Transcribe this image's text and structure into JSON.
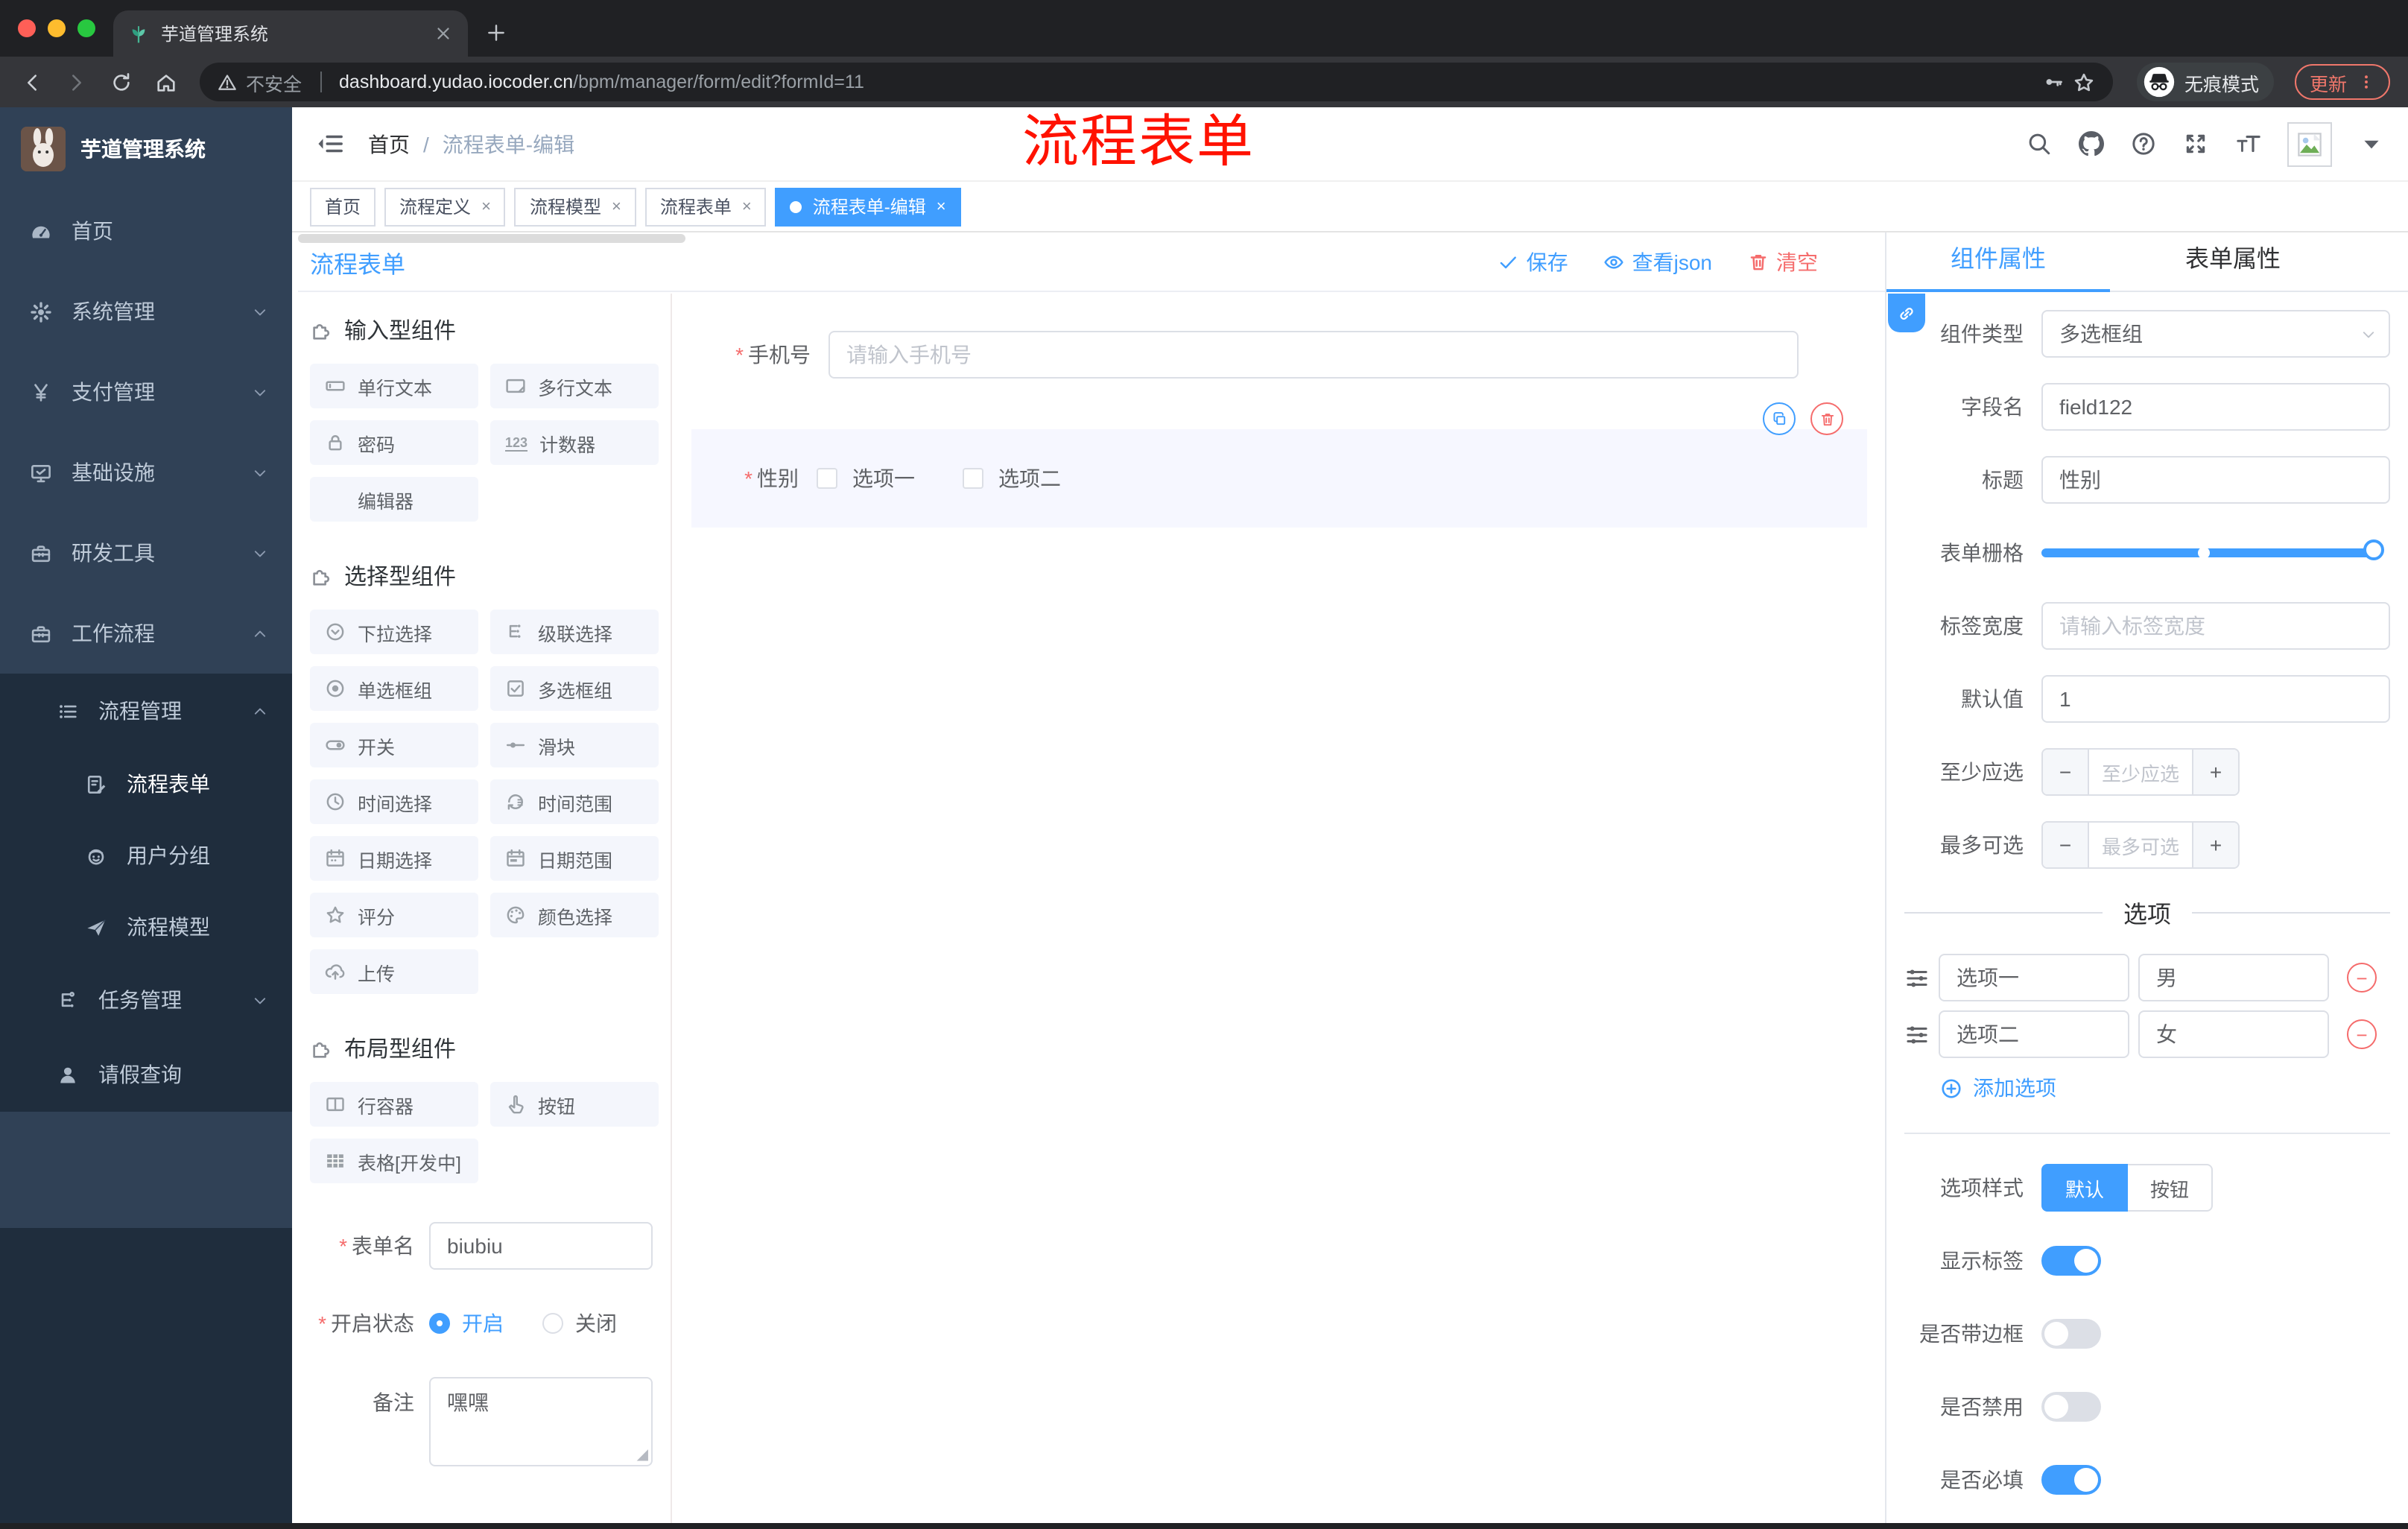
{
  "browser": {
    "tab_title": "芋道管理系统",
    "security_label": "不安全",
    "url_host": "dashboard.yudao.iocoder.cn",
    "url_path": "/bpm/manager/form/edit?formId=11",
    "incognito_label": "无痕模式",
    "update_label": "更新"
  },
  "annotation": {
    "text": "流程表单",
    "color": "#ff1200"
  },
  "sidebar": {
    "title": "芋道管理系统",
    "items": [
      {
        "icon": "gauge",
        "label": "首页"
      },
      {
        "icon": "gear",
        "label": "系统管理",
        "arrow": "down"
      },
      {
        "icon": "yen",
        "label": "支付管理",
        "arrow": "down"
      },
      {
        "icon": "monitor",
        "label": "基础设施",
        "arrow": "down"
      },
      {
        "icon": "toolbox",
        "label": "研发工具",
        "arrow": "down"
      },
      {
        "icon": "briefcase",
        "label": "工作流程",
        "arrow": "up",
        "open": true,
        "children": [
          {
            "icon": "list",
            "label": "流程管理",
            "arrow": "up",
            "open": true,
            "children": [
              {
                "icon": "doc-edit",
                "label": "流程表单",
                "active": true
              },
              {
                "icon": "robot",
                "label": "用户分组"
              },
              {
                "icon": "plane",
                "label": "流程模型"
              }
            ]
          },
          {
            "icon": "tree",
            "label": "任务管理",
            "arrow": "down"
          },
          {
            "icon": "person",
            "label": "请假查询"
          }
        ]
      }
    ]
  },
  "header": {
    "breadcrumb": [
      "首页",
      "流程表单-编辑"
    ],
    "icons": [
      "search",
      "github",
      "question",
      "fullscreen",
      "font-size"
    ]
  },
  "tags": [
    {
      "label": "首页",
      "closable": false,
      "active": false
    },
    {
      "label": "流程定义",
      "closable": true,
      "active": false
    },
    {
      "label": "流程模型",
      "closable": true,
      "active": false
    },
    {
      "label": "流程表单",
      "closable": true,
      "active": false
    },
    {
      "label": "流程表单-编辑",
      "closable": true,
      "active": true
    }
  ],
  "designer": {
    "title": "流程表单",
    "actions": [
      {
        "icon": "check",
        "label": "保存",
        "style": "primary"
      },
      {
        "icon": "eye",
        "label": "查看json",
        "style": "primary"
      },
      {
        "icon": "trash",
        "label": "清空",
        "style": "danger"
      }
    ]
  },
  "palette": {
    "sections": [
      {
        "title": "输入型组件",
        "items": [
          {
            "icon": "input",
            "label": "单行文本"
          },
          {
            "icon": "textarea",
            "label": "多行文本"
          },
          {
            "icon": "lock",
            "label": "密码"
          },
          {
            "icon": "counter",
            "label": "计数器"
          },
          {
            "icon": "none",
            "label": "编辑器"
          }
        ]
      },
      {
        "title": "选择型组件",
        "items": [
          {
            "icon": "select",
            "label": "下拉选择"
          },
          {
            "icon": "cascade",
            "label": "级联选择"
          },
          {
            "icon": "radio",
            "label": "单选框组"
          },
          {
            "icon": "checkbox",
            "label": "多选框组"
          },
          {
            "icon": "switch",
            "label": "开关"
          },
          {
            "icon": "slider",
            "label": "滑块"
          },
          {
            "icon": "time",
            "label": "时间选择"
          },
          {
            "icon": "time-range",
            "label": "时间范围"
          },
          {
            "icon": "date",
            "label": "日期选择"
          },
          {
            "icon": "date-range",
            "label": "日期范围"
          },
          {
            "icon": "star",
            "label": "评分"
          },
          {
            "icon": "palette",
            "label": "颜色选择"
          },
          {
            "icon": "upload",
            "label": "上传"
          }
        ]
      },
      {
        "title": "布局型组件",
        "items": [
          {
            "icon": "columns",
            "label": "行容器"
          },
          {
            "icon": "hand",
            "label": "按钮"
          },
          {
            "icon": "table",
            "label": "表格[开发中]"
          }
        ]
      }
    ],
    "form": {
      "name_label": "表单名",
      "name_value": "biubiu",
      "status_label": "开启状态",
      "status_options": [
        "开启",
        "关闭"
      ],
      "status_selected": "开启",
      "remark_label": "备注",
      "remark_value": "嘿嘿"
    }
  },
  "canvas": {
    "phone": {
      "label": "手机号",
      "placeholder": "请输入手机号"
    },
    "gender": {
      "label": "性别",
      "options": [
        "选项一",
        "选项二"
      ]
    }
  },
  "props": {
    "tabs": [
      "组件属性",
      "表单属性"
    ],
    "active_tab": "组件属性",
    "fields": {
      "type_label": "组件类型",
      "type_value": "多选框组",
      "name_label": "字段名",
      "name_value": "field122",
      "title_label": "标题",
      "title_value": "性别",
      "grid_label": "表单栅格",
      "width_label": "标签宽度",
      "width_placeholder": "请输入标签宽度",
      "default_label": "默认值",
      "default_value": "1",
      "min_label": "至少应选",
      "min_placeholder": "至少应选",
      "max_label": "最多可选",
      "max_placeholder": "最多可选"
    },
    "options_title": "选项",
    "options": [
      {
        "label": "选项一",
        "value": "男"
      },
      {
        "label": "选项二",
        "value": "女"
      }
    ],
    "add_option_label": "添加选项",
    "style_label": "选项样式",
    "style_options": [
      "默认",
      "按钮"
    ],
    "style_selected": "默认",
    "toggles": [
      {
        "label": "显示标签",
        "on": true
      },
      {
        "label": "是否带边框",
        "on": false
      },
      {
        "label": "是否禁用",
        "on": false
      },
      {
        "label": "是否必填",
        "on": true
      }
    ]
  },
  "colors": {
    "primary": "#409eff",
    "danger": "#f56c6c",
    "sidebar_bg": "#304156",
    "submenu_bg": "#1f2d3d"
  }
}
